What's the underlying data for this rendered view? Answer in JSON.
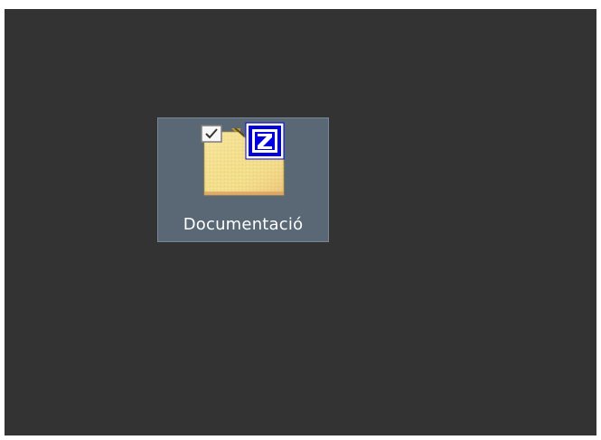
{
  "desktop": {
    "background_color": "#333333",
    "selection_color": "#596874",
    "icons": [
      {
        "label": "Documentació",
        "icon": "folder-icon",
        "overlay_badge": "z-badge-icon",
        "checkbox_checked": true,
        "selected": true
      }
    ]
  }
}
